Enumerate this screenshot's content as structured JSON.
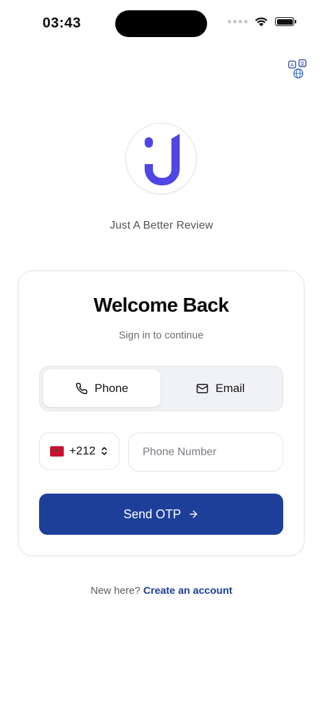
{
  "status_bar": {
    "time": "03:43"
  },
  "header": {
    "language_icon": "language-translate-icon"
  },
  "branding": {
    "logo_icon": "app-logo-icon",
    "tagline": "Just A Better Review",
    "brand_color": "#4f46e5"
  },
  "card": {
    "title": "Welcome Back",
    "subtitle": "Sign in to continue",
    "tabs": [
      {
        "label": "Phone",
        "icon": "phone-icon",
        "active": true
      },
      {
        "label": "Email",
        "icon": "mail-icon",
        "active": false
      }
    ],
    "country": {
      "flag": "morocco-flag-icon",
      "code": "+212"
    },
    "phone_field": {
      "value": "",
      "placeholder": "Phone Number"
    },
    "submit": {
      "label": "Send OTP",
      "icon": "arrow-right-icon",
      "color": "#1e3f99"
    }
  },
  "footer": {
    "prompt": "New here?",
    "link_label": "Create an account"
  }
}
